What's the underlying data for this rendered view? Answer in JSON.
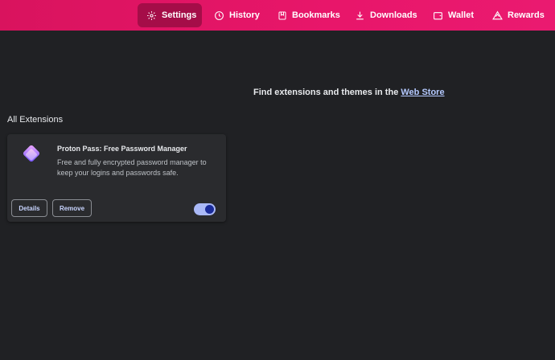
{
  "nav": {
    "items": [
      {
        "label": "Settings",
        "icon": "gear-icon",
        "active": true
      },
      {
        "label": "History",
        "icon": "history-icon",
        "active": false
      },
      {
        "label": "Bookmarks",
        "icon": "bookmark-icon",
        "active": false
      },
      {
        "label": "Downloads",
        "icon": "download-icon",
        "active": false
      },
      {
        "label": "Wallet",
        "icon": "wallet-icon",
        "active": false
      },
      {
        "label": "Rewards",
        "icon": "rewards-icon",
        "active": false
      }
    ]
  },
  "main": {
    "store_message_prefix": "Find extensions and themes in the",
    "store_link": "Web Store",
    "section_title": "All Extensions"
  },
  "extension": {
    "name": "Proton Pass: Free Password Manager",
    "description": "Free and fully encrypted password manager to keep your logins and passwords safe.",
    "details_label": "Details",
    "remove_label": "Remove",
    "enabled": true
  },
  "colors": {
    "topbar": "#e0145f",
    "active_nav": "#a50d48",
    "background": "#202124",
    "card": "#2a2b2e",
    "link": "#b4c9ff",
    "toggle_track": "#aab9f7",
    "toggle_knob": "#1a2b9a"
  }
}
